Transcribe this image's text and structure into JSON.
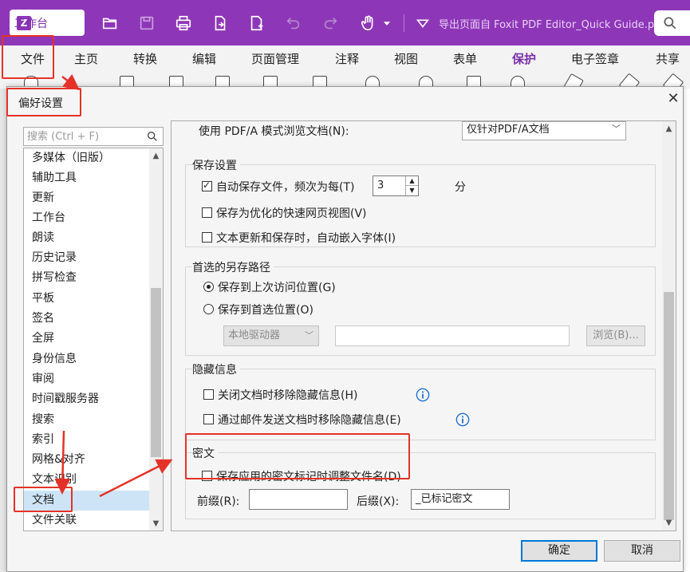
{
  "app": {
    "workbench_label": "工作台",
    "workbench_logo": "Z",
    "document_title": "导出页面自 Foxit PDF Editor_Quick Guide.pdf",
    "accent_color": "#8e36b8"
  },
  "toolbar_icons": [
    "open-folder-icon",
    "save-icon",
    "print-icon",
    "file-export-icon",
    "new-file-icon",
    "undo-icon",
    "redo-icon",
    "hand-tool-icon",
    "dropdown-icon",
    "customize-icon",
    "search-icon"
  ],
  "menu": {
    "items": [
      "文件",
      "主页",
      "转换",
      "编辑",
      "页面管理",
      "注释",
      "视图",
      "表单",
      "保护",
      "电子签章",
      "共享"
    ],
    "active": "保护"
  },
  "dialog": {
    "title": "偏好设置",
    "close_label": "✕",
    "search_placeholder": "搜索 (Ctrl + F)",
    "categories": [
      "多媒体（旧版）",
      "辅助工具",
      "更新",
      "工作台",
      "朗读",
      "历史记录",
      "拼写检查",
      "平板",
      "签名",
      "全屏",
      "身份信息",
      "审阅",
      "时间戳服务器",
      "搜索",
      "索引",
      "网格&对齐",
      "文本识别",
      "文档",
      "文件关联"
    ],
    "selected_category": "文档",
    "pdfa": {
      "label": "使用 PDF/A 模式浏览文档(N):",
      "value": "仅针对PDF/A文档"
    },
    "save_settings": {
      "title": "保存设置",
      "auto_save_label": "自动保存文件，频次为每(T)",
      "auto_save_checked": true,
      "auto_save_value": "3",
      "auto_save_unit": "分",
      "fast_web_label": "保存为优化的快速网页视图(V)",
      "fast_web_checked": false,
      "embed_font_label": "文本更新和保存时，自动嵌入字体(I)",
      "embed_font_checked": false
    },
    "save_as_path": {
      "title": "首选的另存路径",
      "last_location_label": "保存到上次访问位置(G)",
      "last_location_selected": true,
      "preferred_label": "保存到首选位置(O)",
      "preferred_selected": false,
      "drive_value": "本地驱动器",
      "path_value": "",
      "browse_label": "浏览(B)..."
    },
    "hidden_info": {
      "title": "隐藏信息",
      "remove_on_close_label": "关闭文档时移除隐藏信息(H)",
      "remove_on_close_checked": false,
      "remove_on_mail_label": "通过邮件发送文档时移除隐藏信息(E)",
      "remove_on_mail_checked": false
    },
    "redaction": {
      "title": "密文",
      "adjust_filename_label": "保存应用的密文标记时调整文件名(D)",
      "adjust_filename_checked": false,
      "prefix_label": "前缀(R):",
      "prefix_value": "",
      "suffix_label": "后缀(X):",
      "suffix_value": "_已标记密文"
    },
    "ok_label": "确定",
    "cancel_label": "取消"
  },
  "annotation_color": "#e53228"
}
